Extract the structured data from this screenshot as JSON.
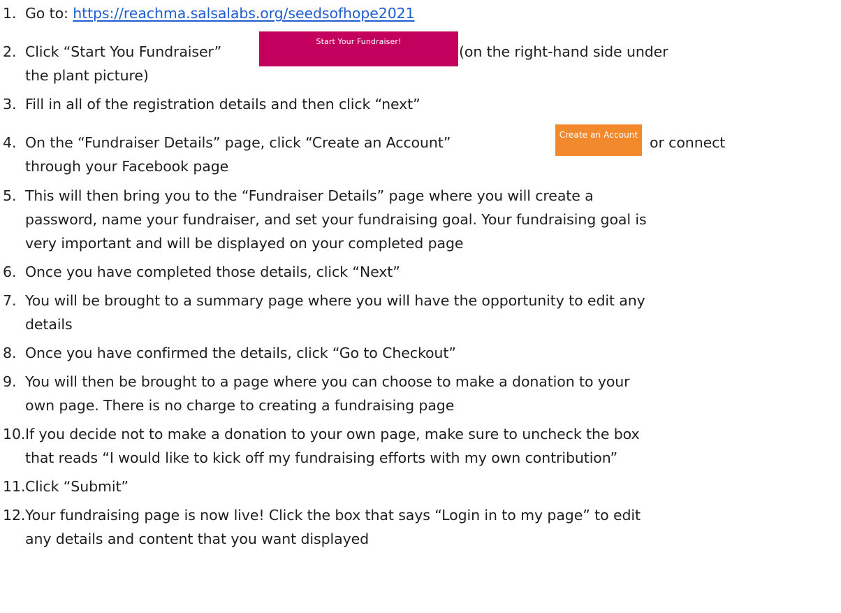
{
  "steps": [
    {
      "num": "1.",
      "prefix": "Go to: ",
      "link": "https://reachma.salsalabs.org/seedsofhope2021"
    },
    {
      "num": "2.",
      "before": "Click “Start You Fundraiser”",
      "button": "Start Your Fundraiser!",
      "after": "(on the right-hand side under",
      "line2": "the plant picture)"
    },
    {
      "num": "3.",
      "text": "Fill in all of the registration details and then click “next”"
    },
    {
      "num": "4.",
      "before": "On the “Fundraiser Details” page, click “Create an Account”",
      "button": "Create an Account",
      "after": "or connect",
      "line2": "through your Facebook page"
    },
    {
      "num": "5.",
      "lines": [
        "This will then bring you to the “Fundraiser Details” page where you will create a",
        "password, name your fundraiser, and set your fundraising goal. Your fundraising goal is",
        "very important and will be displayed on your completed page"
      ]
    },
    {
      "num": "6.",
      "text": "Once you have completed those details, click “Next”"
    },
    {
      "num": "7.",
      "lines": [
        "You will be brought to a summary page where you will have the opportunity to edit any",
        "details"
      ]
    },
    {
      "num": "8.",
      "text": "Once you have confirmed the details, click “Go to Checkout”"
    },
    {
      "num": "9.",
      "lines": [
        "You will then be brought to a page where you can choose to make a donation to your",
        "own page. There is no charge to creating a fundraising page"
      ]
    },
    {
      "num": "10.",
      "lines": [
        "If you decide not to make a donation to your own page, make sure to uncheck the box",
        "that reads “I would like to kick off my fundraising efforts with my own contribution”"
      ]
    },
    {
      "num": "11.",
      "text": "Click “Submit”"
    },
    {
      "num": "12.",
      "lines": [
        "Your fundraising page is now live! Click the box that says “Login in to my page” to edit",
        "any details and content that you want displayed"
      ]
    }
  ],
  "colors": {
    "link": "#1f5fd1",
    "fundraiser_button": "#c4005e",
    "account_button": "#f2892c",
    "text": "#1f1f1f"
  }
}
